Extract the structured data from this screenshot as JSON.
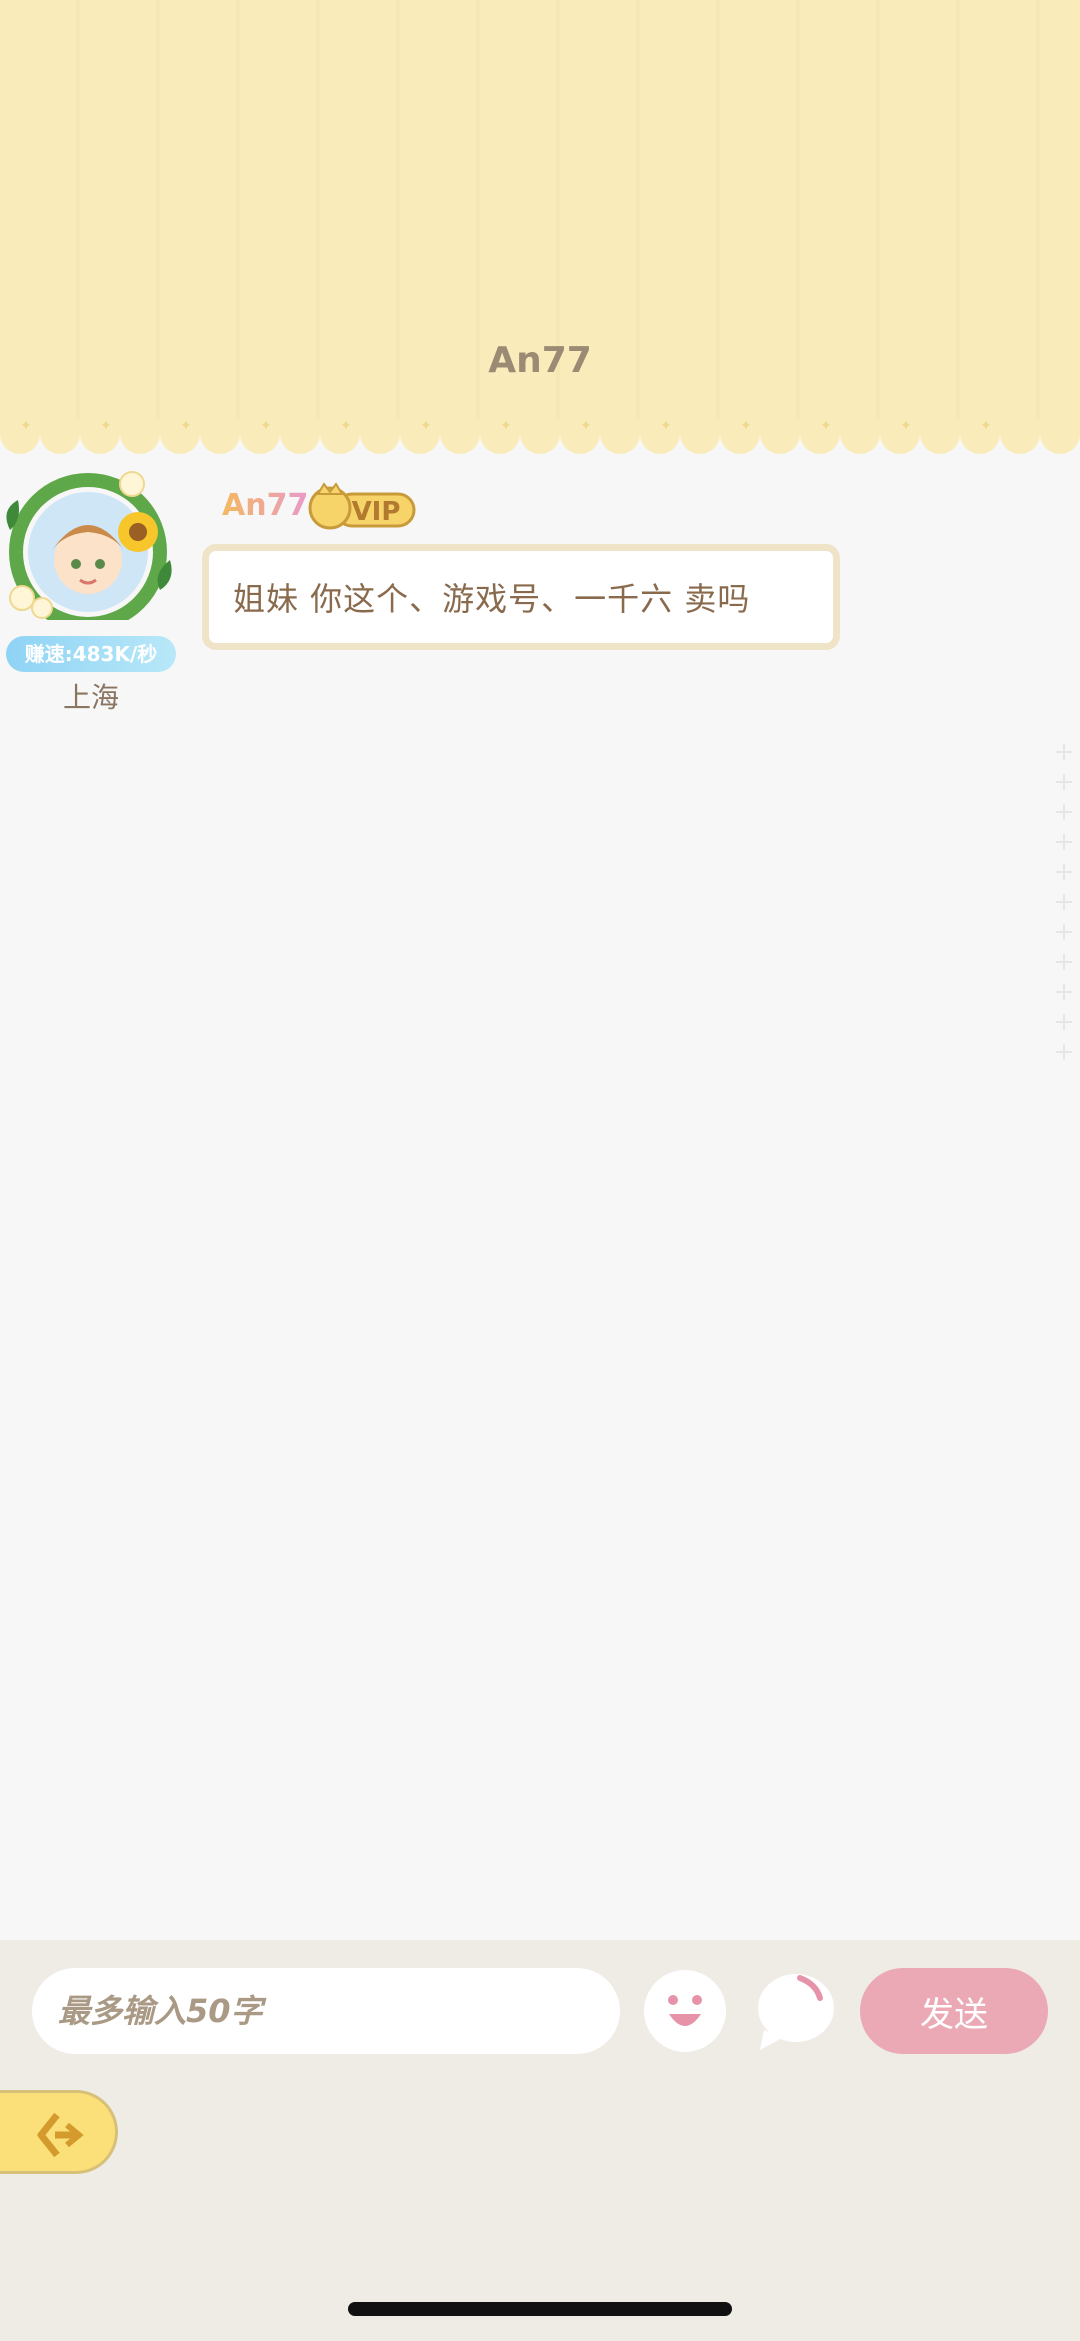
{
  "header": {
    "title": "An77"
  },
  "message": {
    "sender": {
      "name": "An77",
      "vip_label": "VIP",
      "speed": "赚速:483K/秒",
      "location": "上海"
    },
    "text": "姐妹 你这个、游戏号、一千六 卖吗"
  },
  "composer": {
    "placeholder": "最多输入50字",
    "send_label": "发送"
  },
  "icons": {
    "emoji": "smiley-icon",
    "bubble": "speech-bubble-icon",
    "back": "back-arrow-icon"
  },
  "colors": {
    "header_bg": "#faecba",
    "send_button": "#eba9b6",
    "back_button": "#fbe07a",
    "bubble_border": "#efe3c8"
  }
}
